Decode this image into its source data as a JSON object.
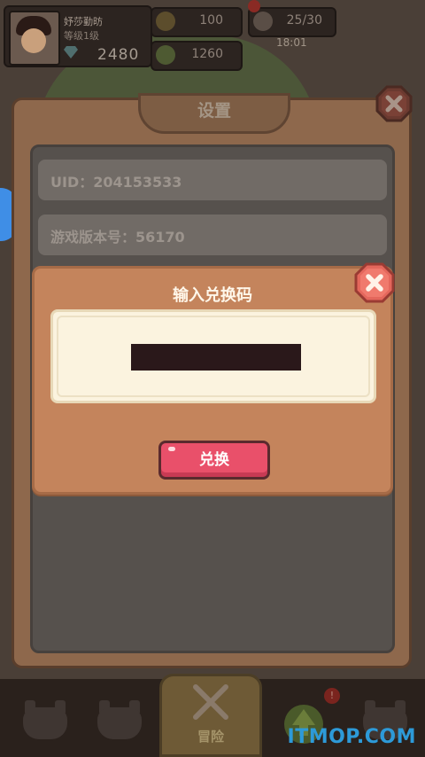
{
  "hud": {
    "player_name": "妤莎勤昉",
    "player_level": "等级1级",
    "diamonds": "2480",
    "coins": "100",
    "gems": "1260",
    "stamina": "25/30",
    "timer": "18:01"
  },
  "settings": {
    "title": "设置",
    "uid": "UID：204153533",
    "version": "游戏版本号：56170"
  },
  "redeem": {
    "title": "输入兑换码",
    "code_value": "",
    "confirm_label": "兑换"
  },
  "bottom_nav": {
    "adventure_label": "冒险",
    "alert_count": "!"
  },
  "watermark": "ITMOP.COM",
  "colors": {
    "dialog": "#c4845c",
    "button": "#e9506a",
    "close": "#d8564a",
    "watermark": "#2d9ad8"
  }
}
